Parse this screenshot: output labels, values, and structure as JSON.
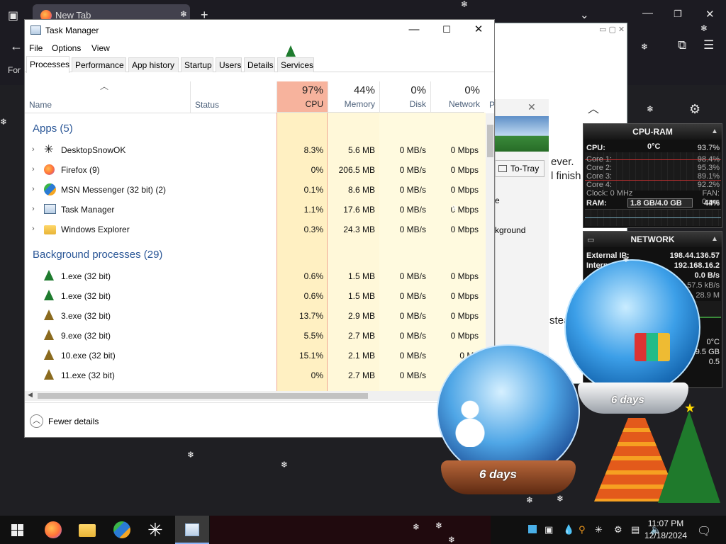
{
  "browser": {
    "tab_title": "New Tab",
    "tab_add": "+",
    "side_label": "For"
  },
  "second_window": {
    "text_lines": [
      "ever.",
      "l finish",
      "stea"
    ],
    "to_tray": "To-Tray",
    "background_frag": "kground",
    "e_frag": "e",
    "close": "✕"
  },
  "task_manager": {
    "title": "Task Manager",
    "menu": [
      "File",
      "Options",
      "View"
    ],
    "tabs": [
      "Processes",
      "Performance",
      "App history",
      "Startup",
      "Users",
      "Details",
      "Services"
    ],
    "active_tab": "Processes",
    "columns": {
      "name": "Name",
      "status": "Status",
      "cpu": {
        "pct": "97%",
        "label": "CPU"
      },
      "memory": {
        "pct": "44%",
        "label": "Memory"
      },
      "disk": {
        "pct": "0%",
        "label": "Disk"
      },
      "network": {
        "pct": "0%",
        "label": "Network"
      },
      "next": "P"
    },
    "apps_header": "Apps (5)",
    "apps": [
      {
        "name": "DesktopSnowOK",
        "cpu": "8.3%",
        "memory": "5.6 MB",
        "disk": "0 MB/s",
        "network": "0 Mbps",
        "icon": "snowflake-icon"
      },
      {
        "name": "Firefox (9)",
        "cpu": "0%",
        "memory": "206.5 MB",
        "disk": "0 MB/s",
        "network": "0 Mbps",
        "icon": "firefox-icon"
      },
      {
        "name": "MSN Messenger (32 bit) (2)",
        "cpu": "0.1%",
        "memory": "8.6 MB",
        "disk": "0 MB/s",
        "network": "0 Mbps",
        "icon": "msn-icon"
      },
      {
        "name": "Task Manager",
        "cpu": "1.1%",
        "memory": "17.6 MB",
        "disk": "0 MB/s",
        "network": "0 Mbps",
        "icon": "task-manager-icon"
      },
      {
        "name": "Windows Explorer",
        "cpu": "0.3%",
        "memory": "24.3 MB",
        "disk": "0 MB/s",
        "network": "0 Mbps",
        "icon": "folder-icon"
      }
    ],
    "bg_header": "Background processes (29)",
    "background": [
      {
        "name": "1.exe (32 bit)",
        "cpu": "0.6%",
        "memory": "1.5 MB",
        "disk": "0 MB/s",
        "network": "0 Mbps"
      },
      {
        "name": "1.exe (32 bit)",
        "cpu": "0.6%",
        "memory": "1.5 MB",
        "disk": "0 MB/s",
        "network": "0 Mbps"
      },
      {
        "name": "3.exe (32 bit)",
        "cpu": "13.7%",
        "memory": "2.9 MB",
        "disk": "0 MB/s",
        "network": "0 Mbps"
      },
      {
        "name": "9.exe (32 bit)",
        "cpu": "5.5%",
        "memory": "2.7 MB",
        "disk": "0 MB/s",
        "network": "0 Mbps"
      },
      {
        "name": "10.exe (32 bit)",
        "cpu": "15.1%",
        "memory": "2.1 MB",
        "disk": "0 MB/s",
        "network": "0 Mb"
      },
      {
        "name": "11.exe (32 bit)",
        "cpu": "0%",
        "memory": "2.7 MB",
        "disk": "0 MB/s",
        "network": "0 Mb"
      }
    ],
    "fewer_details": "Fewer details"
  },
  "cpu_gadget": {
    "title": "CPU-RAM",
    "cpu_label": "CPU:",
    "cpu_temp": "0°C",
    "cpu_total": "93.7%",
    "cores": [
      {
        "label": "Core 1:",
        "value": "98.4%"
      },
      {
        "label": "Core 2:",
        "value": "95.3%"
      },
      {
        "label": "Core 3:",
        "value": "89.1%"
      },
      {
        "label": "Core 4:",
        "value": "92.2%"
      }
    ],
    "clock": "Clock: 0 MHz",
    "fan": "FAN: 0rpm",
    "ram_label": "RAM:",
    "ram_value": "1.8 GB/4.0 GB",
    "ram_pct": "44%"
  },
  "net_gadget": {
    "title": "NETWORK",
    "external_label": "External IP:",
    "external_ip": "198.44.136.57",
    "internal_label": "Internal",
    "internal_ip": "192.168.16.2",
    "rate1": "0.0 B/s",
    "rate2": "57.5 kB/s",
    "rate3": "28.9 M",
    "temp": "0°C",
    "size": "9.5 GB",
    "pct": "0.5"
  },
  "globes": {
    "left_days": "6 days",
    "right_days": "6 days"
  },
  "taskbar": {
    "time": "11:07 PM",
    "date": "12/18/2024"
  },
  "colors": {
    "cpu_header": "#f7b39d",
    "cpu_col": "#fff0c2",
    "other_col": "#fffadf",
    "accent": "#2b5797"
  }
}
